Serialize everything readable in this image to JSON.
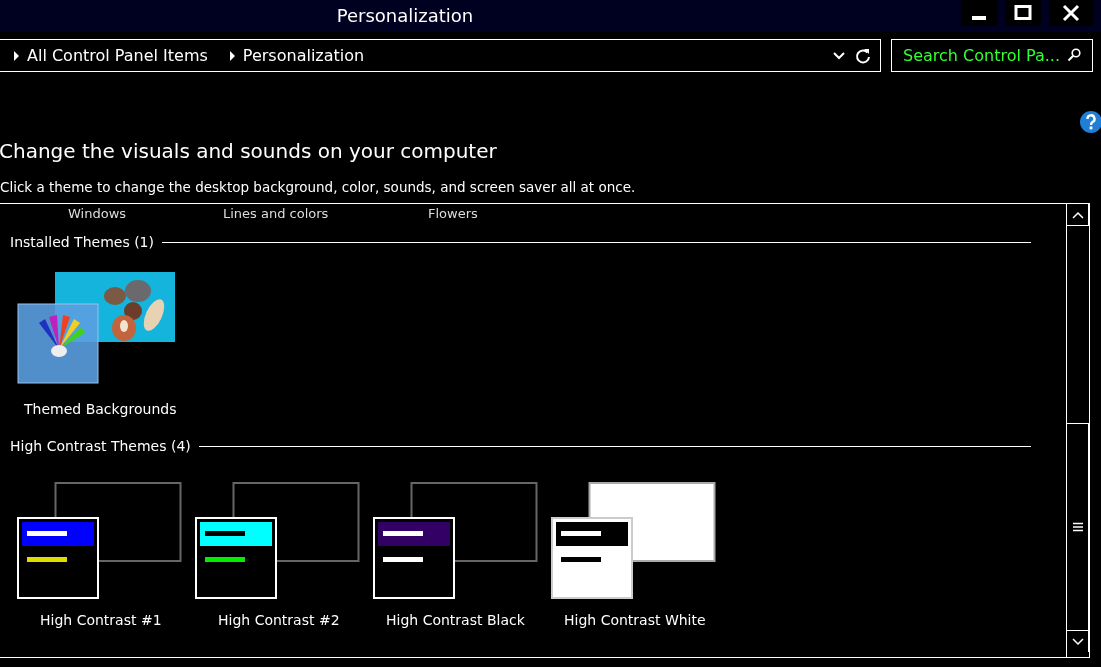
{
  "window": {
    "title": "Personalization"
  },
  "address_bar": {
    "crumbs": [
      "All Control Panel Items",
      "Personalization"
    ]
  },
  "search": {
    "placeholder": "Search Control Pa..."
  },
  "heading": "Change the visuals and sounds on your computer",
  "subtitle": "Click a theme to change the desktop background, color, sounds, and screen saver all at once.",
  "partial_themes": [
    "Windows",
    "Lines and colors",
    "Flowers"
  ],
  "groups": [
    {
      "title": "Installed Themes (1)",
      "themes": [
        {
          "kind": "picture",
          "label": "Themed Backgrounds"
        }
      ]
    },
    {
      "title": "High Contrast Themes (4)",
      "themes": [
        {
          "kind": "hc1",
          "label": "High Contrast #1"
        },
        {
          "kind": "hc2",
          "label": "High Contrast #2"
        },
        {
          "kind": "black",
          "label": "High Contrast Black"
        },
        {
          "kind": "white",
          "label": "High Contrast White"
        }
      ]
    }
  ]
}
